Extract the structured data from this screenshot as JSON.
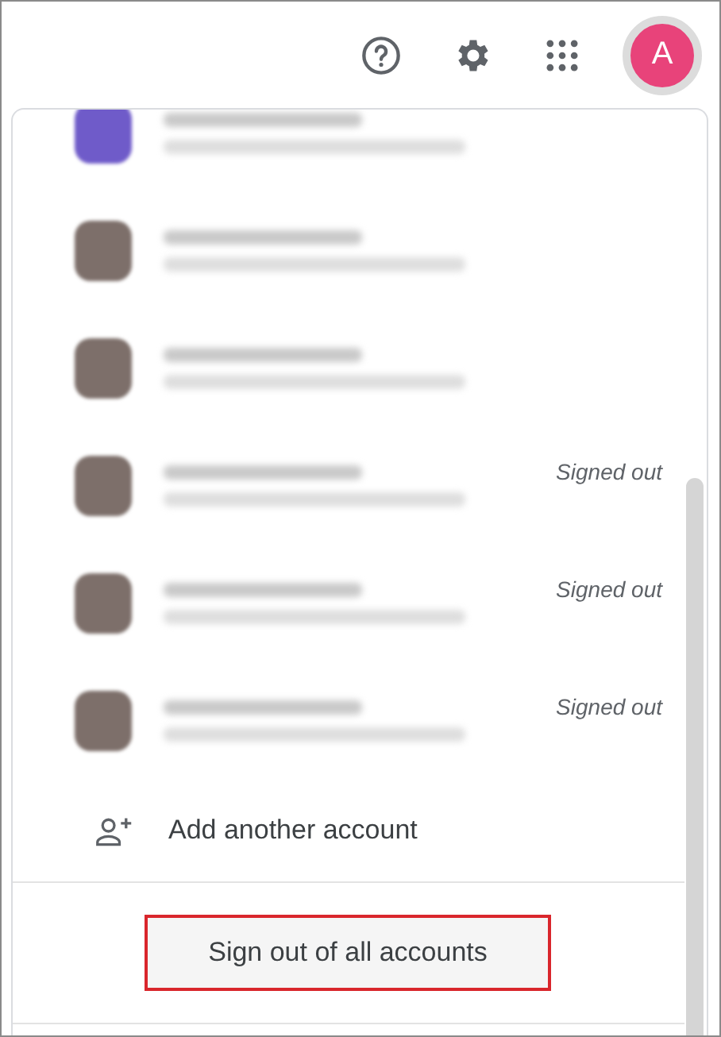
{
  "header": {
    "avatar_letter": "A"
  },
  "accounts": [
    {
      "kind": "active"
    },
    {
      "kind": "active"
    },
    {
      "kind": "active"
    },
    {
      "kind": "signed_out",
      "status": "Signed out"
    },
    {
      "kind": "signed_out",
      "status": "Signed out"
    },
    {
      "kind": "signed_out",
      "status": "Signed out"
    }
  ],
  "add_account": {
    "label": "Add another account"
  },
  "sign_out_button": {
    "label": "Sign out of all accounts",
    "highlighted": true
  }
}
